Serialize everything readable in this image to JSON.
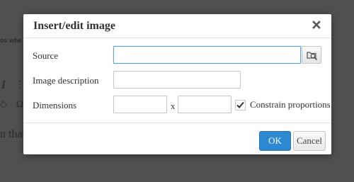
{
  "background": {
    "top_text": "os whe",
    "italic_glyph": "I",
    "list_glyph": "⋮",
    "erase_glyph": "◇",
    "omega_glyph": "Ω",
    "body_text": "n that"
  },
  "dialog": {
    "title": "Insert/edit image",
    "close_icon": "close-icon",
    "source": {
      "label": "Source",
      "value": "",
      "browse_icon": "browse-image-icon"
    },
    "description": {
      "label": "Image description",
      "value": ""
    },
    "dimensions": {
      "label": "Dimensions",
      "width": "",
      "height": "",
      "separator": "x",
      "constrain_label": "Constrain proportions",
      "constrain_checked": true
    },
    "ok_label": "OK",
    "cancel_label": "Cancel"
  },
  "colors": {
    "overlay": "#505050",
    "primary": "#2d8ad2",
    "focus_border": "#59a5e5"
  }
}
